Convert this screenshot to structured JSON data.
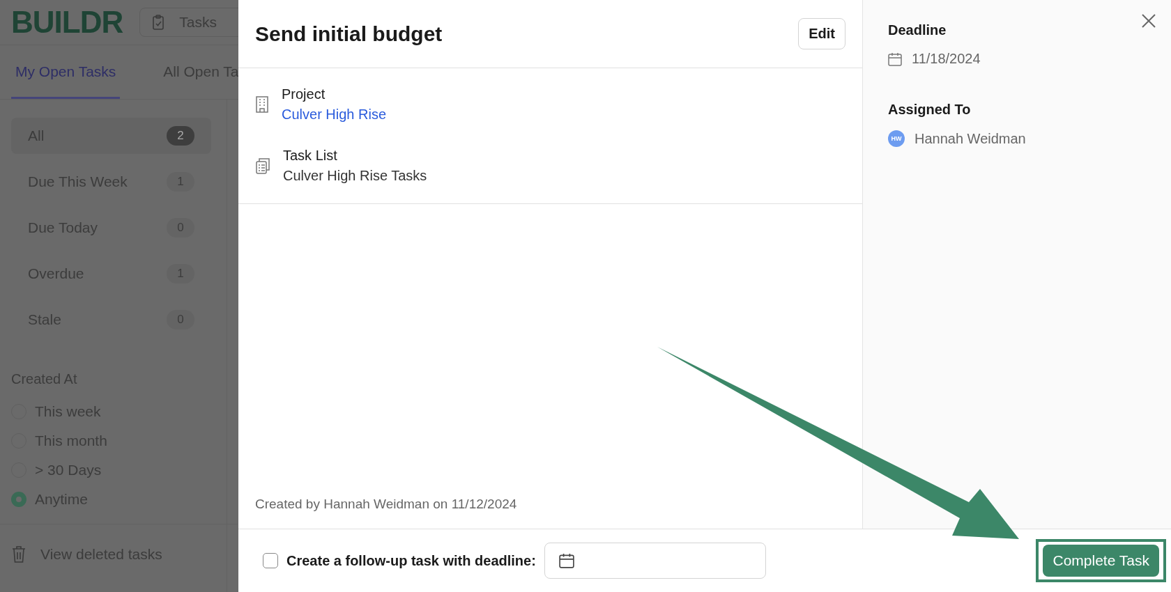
{
  "app": {
    "logo": "BUILDR",
    "module_menu": {
      "label": "Tasks"
    },
    "tabs": [
      {
        "label": "My Open Tasks",
        "selected": true
      },
      {
        "label": "All Open Ta",
        "selected": false
      }
    ],
    "filters": [
      {
        "label": "All",
        "count": "2",
        "selected": true
      },
      {
        "label": "Due This Week",
        "count": "1",
        "selected": false
      },
      {
        "label": "Due Today",
        "count": "0",
        "selected": false
      },
      {
        "label": "Overdue",
        "count": "1",
        "selected": false
      },
      {
        "label": "Stale",
        "count": "0",
        "selected": false
      }
    ],
    "created_at": {
      "title": "Created At",
      "options": [
        {
          "label": "This week",
          "selected": false
        },
        {
          "label": "This month",
          "selected": false
        },
        {
          "label": "> 30 Days",
          "selected": false
        },
        {
          "label": "Anytime",
          "selected": true
        }
      ]
    },
    "deleted_link": "View deleted tasks"
  },
  "task_modal": {
    "title": "Send initial budget",
    "edit_button": "Edit",
    "details": [
      {
        "kind": "project",
        "label": "Project",
        "value": "Culver High Rise",
        "link": true
      },
      {
        "kind": "task_list",
        "label": "Task List",
        "value": "Culver High Rise Tasks",
        "link": false
      }
    ],
    "created_note": "Created by Hannah Weidman on 11/12/2024",
    "deadline": {
      "label": "Deadline",
      "date": "11/18/2024"
    },
    "assignee": {
      "label": "Assigned To",
      "initials": "HW",
      "name": "Hannah Weidman"
    },
    "follow_up": {
      "label": "Create a follow-up task with deadline:",
      "checked": false
    },
    "complete_button": "Complete Task"
  }
}
